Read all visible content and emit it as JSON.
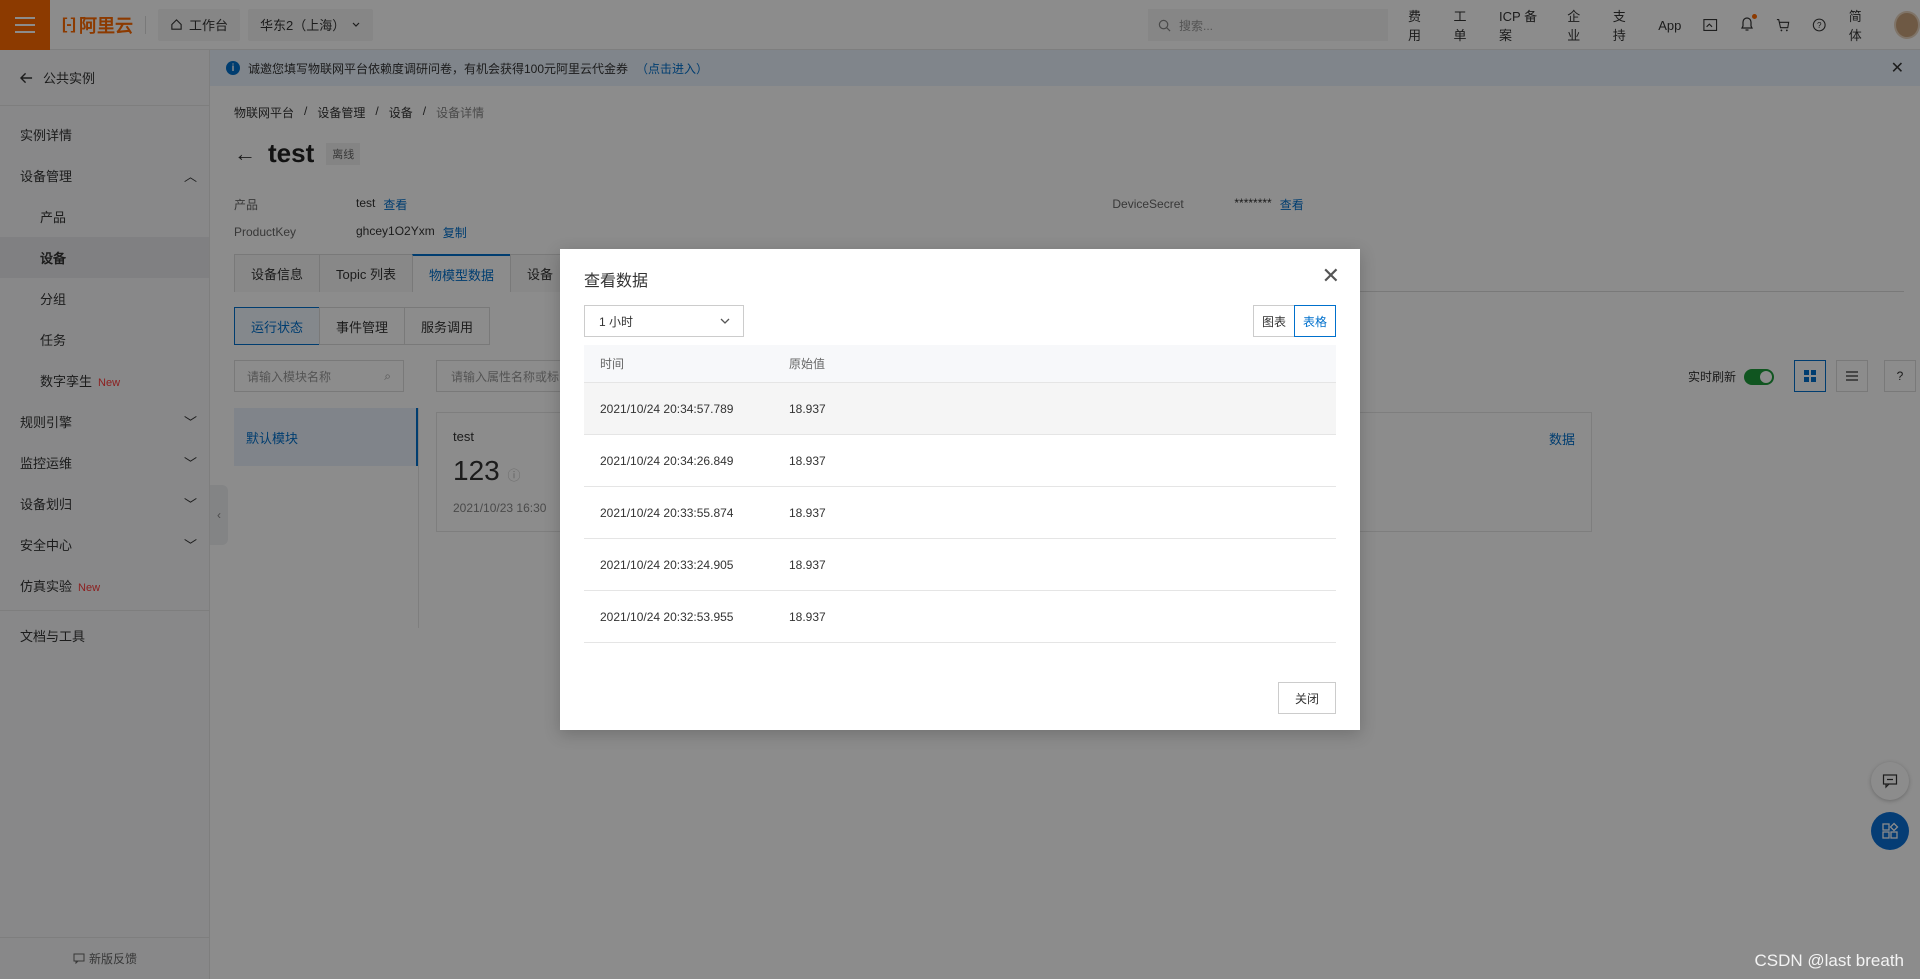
{
  "topbar": {
    "brand": "阿里云",
    "workbench": "工作台",
    "region": "华东2（上海）",
    "search_placeholder": "搜索...",
    "links": [
      "费用",
      "工单",
      "ICP 备案",
      "企业",
      "支持",
      "App"
    ],
    "lang": "简体"
  },
  "sidebar": {
    "back": "公共实例",
    "items": [
      {
        "label": "实例详情"
      },
      {
        "label": "设备管理"
      },
      {
        "label": "产品"
      },
      {
        "label": "设备"
      },
      {
        "label": "分组"
      },
      {
        "label": "任务"
      },
      {
        "label": "数字孪生",
        "tag": "New"
      },
      {
        "label": "规则引擎"
      },
      {
        "label": "监控运维"
      },
      {
        "label": "设备划归"
      },
      {
        "label": "安全中心"
      },
      {
        "label": "仿真实验",
        "tag": "New"
      },
      {
        "label": "文档与工具"
      }
    ],
    "feedback": "新版反馈"
  },
  "notice": {
    "text": "诚邀您填写物联网平台依赖度调研问卷，有机会获得100元阿里云代金券",
    "link": "（点击进入）"
  },
  "breadcrumb": [
    "物联网平台",
    "设备管理",
    "设备",
    "设备详情"
  ],
  "device": {
    "name": "test",
    "status": "离线",
    "product_label": "产品",
    "product_value": "test",
    "view_link": "查看",
    "productkey_label": "ProductKey",
    "productkey_value": "ghcey1O2Yxm",
    "copy_link": "复制",
    "secret_label": "DeviceSecret",
    "secret_value": "********",
    "secret_view": "查看"
  },
  "tabs": [
    "设备信息",
    "Topic 列表",
    "物模型数据",
    "设备"
  ],
  "subtabs": [
    "运行状态",
    "事件管理",
    "服务调用"
  ],
  "module_search_placeholder": "请输入模块名称",
  "property_search_placeholder": "请输入属性名称或标",
  "module_default": "默认模块",
  "realtime_label": "实时刷新",
  "card": {
    "name": "test",
    "value": "123",
    "time": "2021/10/23 16:30",
    "view": "数据"
  },
  "dialog": {
    "title": "查看数据",
    "range": "1 小时",
    "seg_chart": "图表",
    "seg_table": "表格",
    "col_time": "时间",
    "col_raw": "原始值",
    "rows": [
      {
        "time": "2021/10/24 20:34:57.789",
        "value": "18.937"
      },
      {
        "time": "2021/10/24 20:34:26.849",
        "value": "18.937"
      },
      {
        "time": "2021/10/24 20:33:55.874",
        "value": "18.937"
      },
      {
        "time": "2021/10/24 20:33:24.905",
        "value": "18.937"
      },
      {
        "time": "2021/10/24 20:32:53.955",
        "value": "18.937"
      }
    ],
    "close_label": "关闭"
  },
  "watermark": "CSDN @last breath"
}
